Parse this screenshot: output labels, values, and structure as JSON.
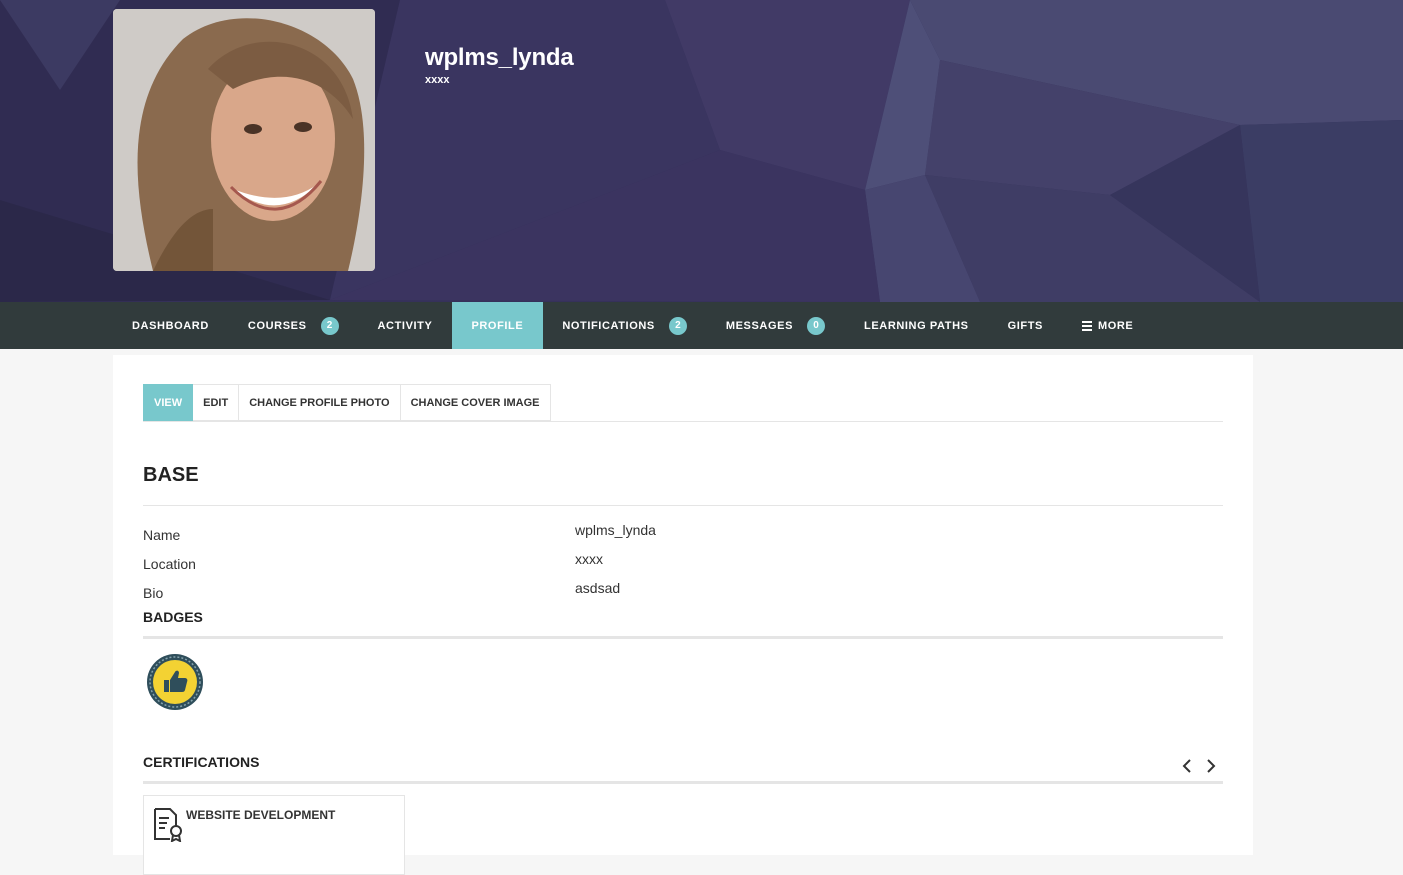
{
  "profile": {
    "username": "wplms_lynda",
    "subtitle": "xxxx"
  },
  "nav": {
    "items": [
      {
        "label": "DASHBOARD"
      },
      {
        "label": "COURSES",
        "count": "2"
      },
      {
        "label": "ACTIVITY"
      },
      {
        "label": "PROFILE",
        "active": true
      },
      {
        "label": "NOTIFICATIONS",
        "count": "2"
      },
      {
        "label": "MESSAGES",
        "count": "0"
      },
      {
        "label": "LEARNING PATHS"
      },
      {
        "label": "GIFTS"
      },
      {
        "label": "MORE",
        "icon": "menu-icon"
      }
    ]
  },
  "subtabs": [
    {
      "label": "VIEW",
      "active": true
    },
    {
      "label": "EDIT"
    },
    {
      "label": "CHANGE PROFILE PHOTO"
    },
    {
      "label": "CHANGE COVER IMAGE"
    }
  ],
  "base": {
    "title": "BASE",
    "fields": [
      {
        "label": "Name",
        "value": "wplms_lynda"
      },
      {
        "label": "Location",
        "value": "xxxx"
      },
      {
        "label": "Bio",
        "value": "asdsad"
      }
    ]
  },
  "badges": {
    "title": "BADGES",
    "items": [
      {
        "icon": "thumbs-up-badge-icon"
      }
    ]
  },
  "certifications": {
    "title": "CERTIFICATIONS",
    "items": [
      {
        "title": "WEBSITE DEVELOPMENT",
        "icon": "certificate-icon"
      }
    ]
  },
  "colors": {
    "accent": "#78c8cc",
    "nav_bg": "#313b3c",
    "cover_bg": "#35315a"
  }
}
